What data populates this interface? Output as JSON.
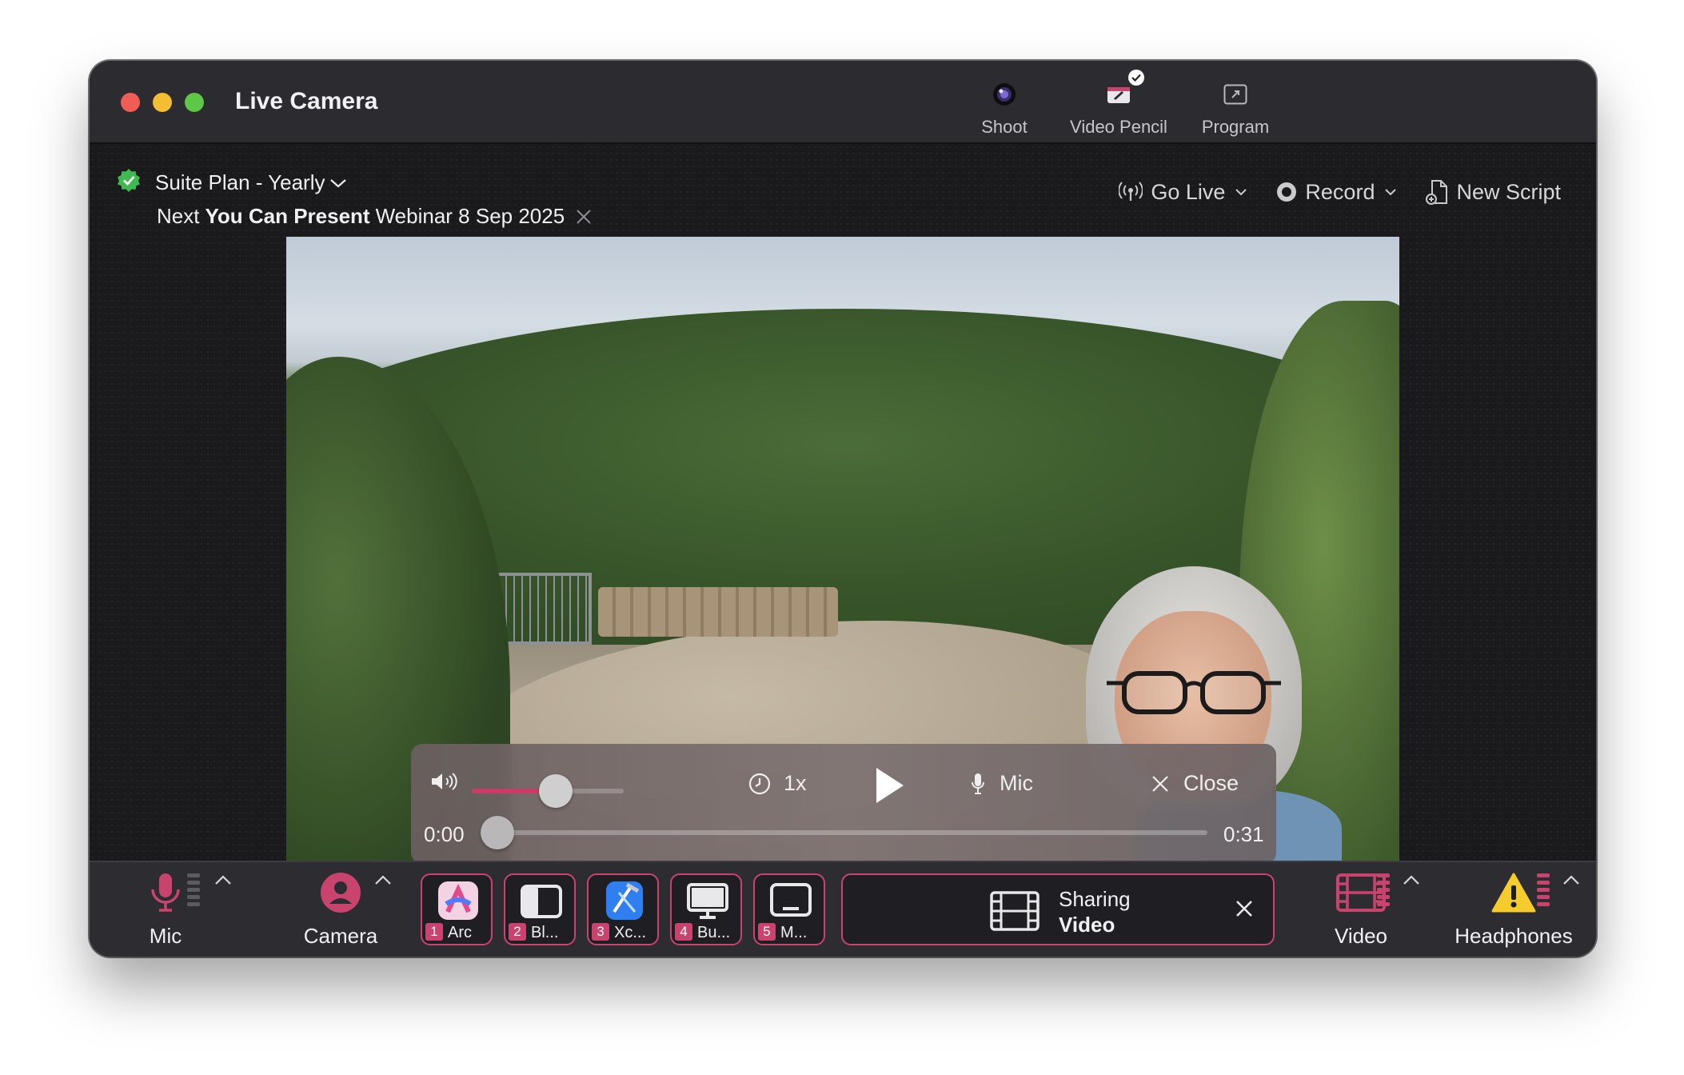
{
  "window": {
    "title": "Live Camera"
  },
  "toolbar": {
    "items": [
      {
        "label": "Shoot",
        "icon": "camera-lens-icon"
      },
      {
        "label": "Video Pencil",
        "icon": "video-pencil-icon",
        "badge": "checkmark"
      },
      {
        "label": "Program",
        "icon": "expand-icon"
      }
    ]
  },
  "plan": {
    "name": "Suite Plan - Yearly",
    "next_prefix": "Next",
    "event_name": "You Can Present",
    "event_suffix": "Webinar 8 Sep 2025"
  },
  "actions": {
    "go_live": "Go Live",
    "record": "Record",
    "new_script": "New Script"
  },
  "player": {
    "volume_level": 0.55,
    "speed": "1x",
    "mic_label": "Mic",
    "close_label": "Close",
    "current_time": "0:00",
    "duration": "0:31",
    "progress": 0
  },
  "bottom": {
    "mic_label": "Mic",
    "camera_label": "Camera",
    "apps": [
      {
        "num": "1",
        "name": "Arc",
        "icon": "arc-icon"
      },
      {
        "num": "2",
        "name": "Bl...",
        "icon": "sidebar-window-icon"
      },
      {
        "num": "3",
        "name": "Xc...",
        "icon": "xcode-icon"
      },
      {
        "num": "4",
        "name": "Bu...",
        "icon": "monitor-icon"
      },
      {
        "num": "5",
        "name": "M...",
        "icon": "display-icon"
      }
    ],
    "sharing": {
      "line1": "Sharing",
      "line2": "Video"
    },
    "video_label": "Video",
    "headphones_label": "Headphones"
  },
  "colors": {
    "accent": "#c8436e",
    "badge_green": "#3fb950",
    "warning": "#f5cc2e"
  }
}
